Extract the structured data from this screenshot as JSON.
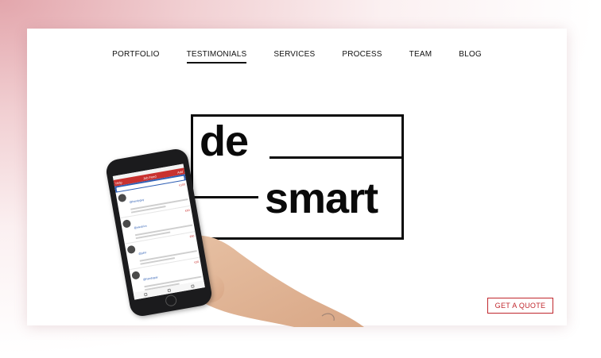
{
  "nav": {
    "items": [
      "PORTFOLIO",
      "TESTIMONIALS",
      "SERVICES",
      "PROCESS",
      "TEAM",
      "BLOG"
    ],
    "active_index": 1
  },
  "logo": {
    "top_text": "de",
    "bottom_text": "smart"
  },
  "cta": {
    "label": "GET A QUOTE"
  },
  "phone": {
    "app_title": "Job Feed",
    "app_left": "Help",
    "app_right": "Add",
    "feed": [
      {
        "user": "@handyguy",
        "price": "€100"
      },
      {
        "user": "@electrics",
        "price": "€60"
      },
      {
        "user": "@john",
        "price": "€50"
      },
      {
        "user": "@handyguy",
        "price": "€30"
      }
    ]
  },
  "colors": {
    "accent": "#c0272d",
    "text": "#111111",
    "background": "#ffffff"
  }
}
